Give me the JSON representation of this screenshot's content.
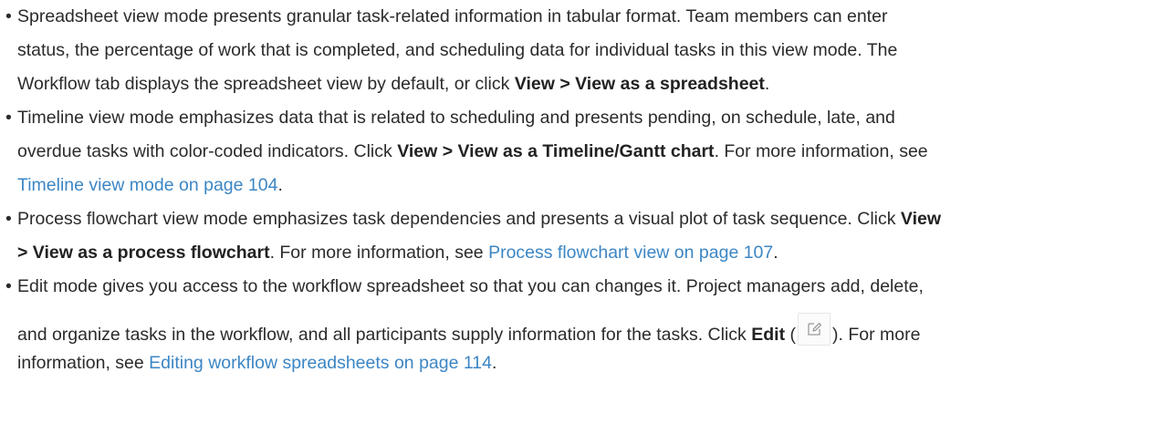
{
  "bullets": [
    {
      "marker": "•",
      "line1": "Spreadsheet view mode presents granular task-related information in tabular format. Team members can enter",
      "line2": "status, the percentage of work that is completed, and scheduling data for individual tasks in this view mode. The",
      "line3_pre": "Workflow tab displays the spreadsheet view by default, or click ",
      "line3_bold": "View > View as a spreadsheet",
      "line3_post": "."
    },
    {
      "marker": "•",
      "line1": "Timeline view mode emphasizes data that is related to scheduling and presents pending, on schedule, late, and",
      "line2_pre": "overdue tasks with color-coded indicators. Click ",
      "line2_bold": "View > View as a Timeline/Gantt chart",
      "line2_post": ". For more information, see",
      "line3_link": "Timeline view mode on page 104",
      "line3_post": "."
    },
    {
      "marker": "•",
      "line1_pre": "Process flowchart view mode emphasizes task dependencies and presents a visual plot of task sequence. Click ",
      "line1_bold": "View",
      "line2_bold": "> View as a process flowchart",
      "line2_mid": ". For more information, see ",
      "line2_link": "Process flowchart view on page 107",
      "line2_post": "."
    },
    {
      "marker": "•",
      "line1": "Edit mode gives you access to the workflow spreadsheet so that you can changes it. Project managers add, delete,",
      "line2_pre": "and organize tasks in the workflow, and all participants supply information for the tasks. Click ",
      "line2_bold": "Edit",
      "line2_paren_open": " (",
      "line2_paren_close": "). For more",
      "line3_pre": "information, see ",
      "line3_link": "Editing workflow spreadsheets on page 114",
      "line3_post": "."
    }
  ],
  "colors": {
    "text": "#2b2b2b",
    "link": "#3c86c4"
  },
  "icons": {
    "edit": "edit-pencil-icon"
  }
}
